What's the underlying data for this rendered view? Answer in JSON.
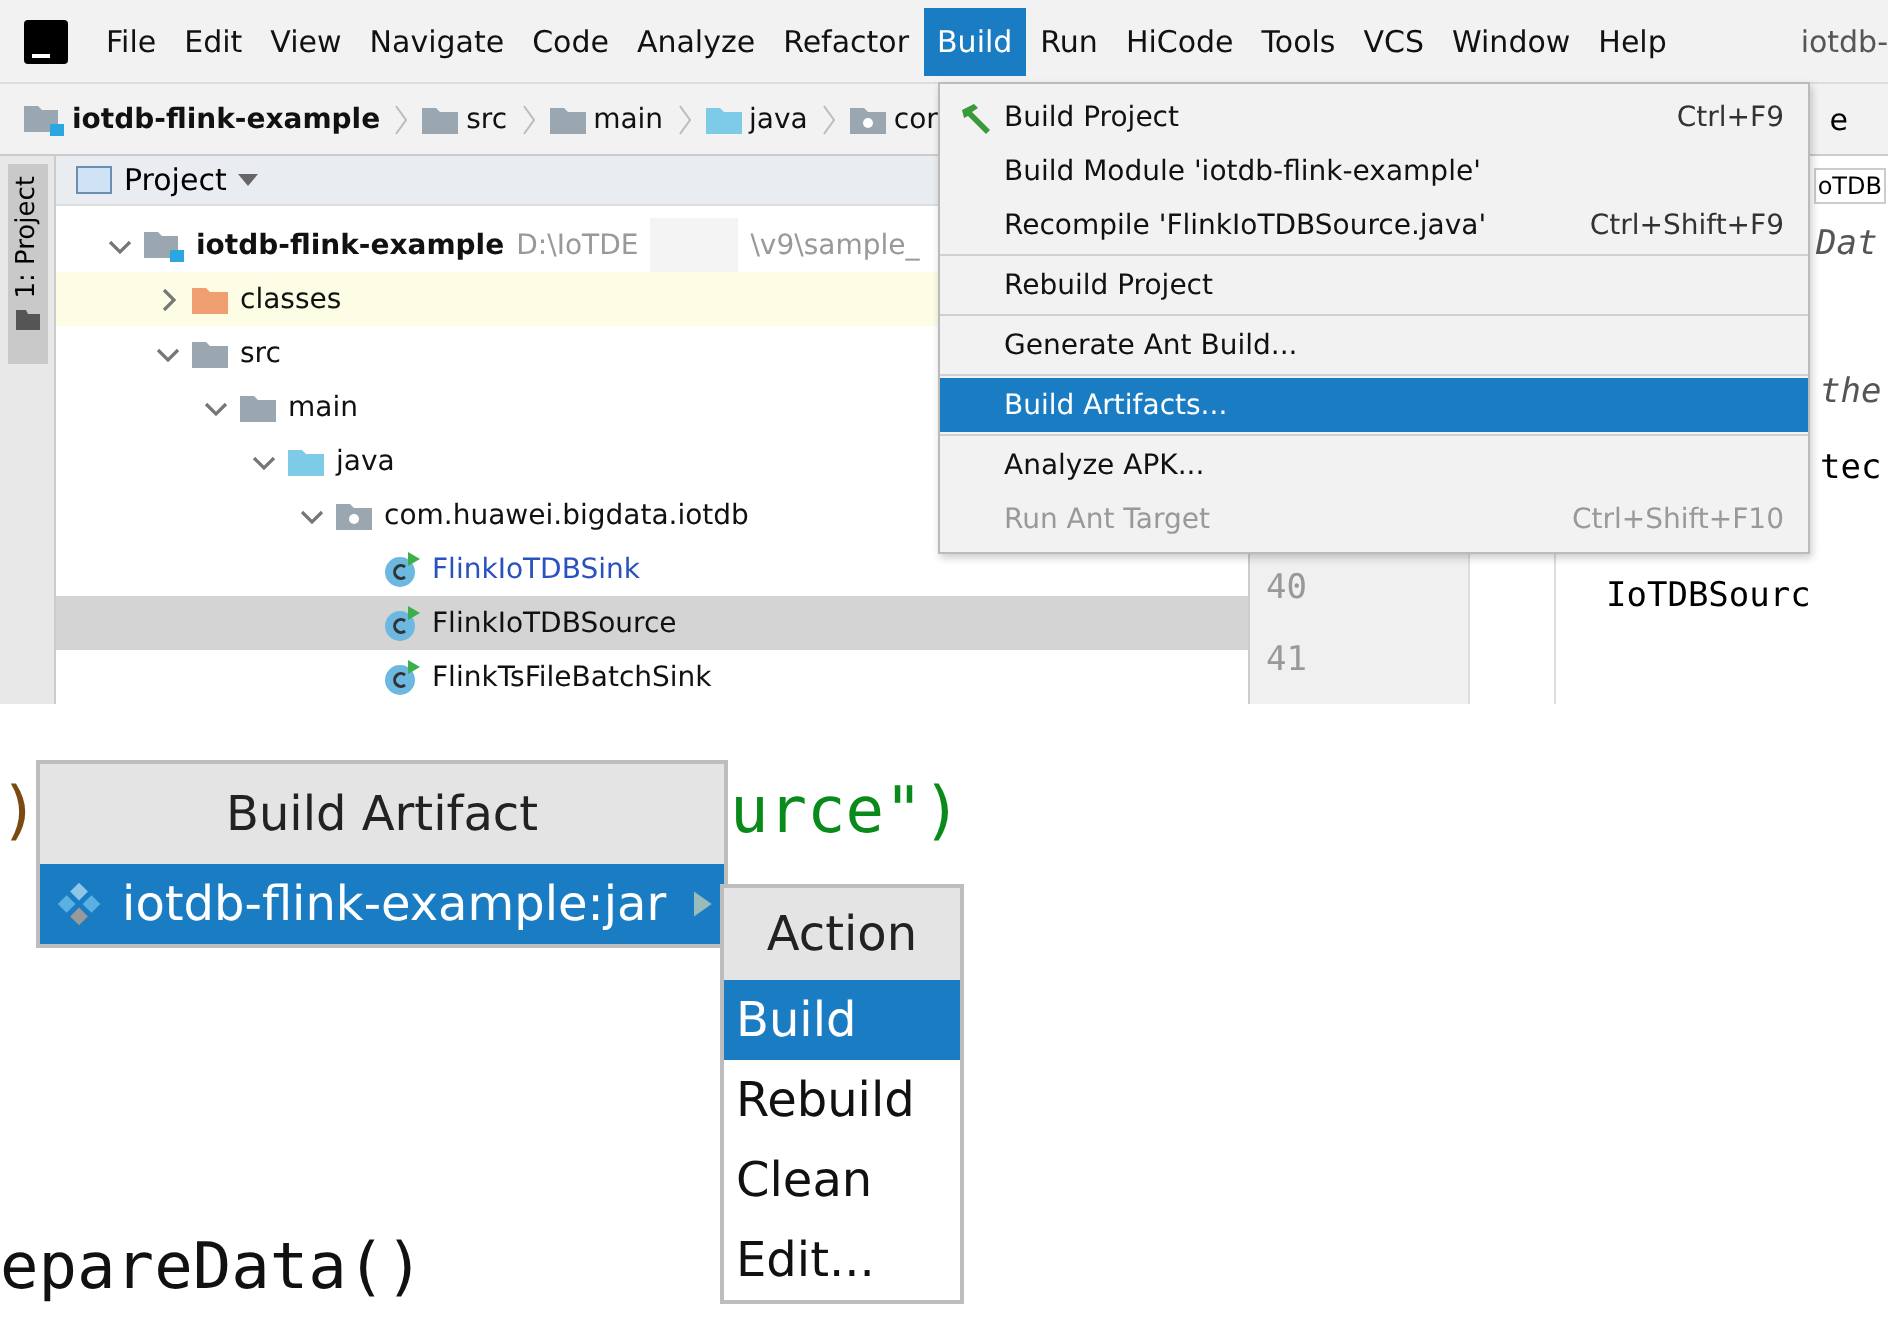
{
  "menubar": {
    "items": [
      {
        "label": "File",
        "selected": false
      },
      {
        "label": "Edit",
        "selected": false
      },
      {
        "label": "View",
        "selected": false
      },
      {
        "label": "Navigate",
        "selected": false
      },
      {
        "label": "Code",
        "selected": false
      },
      {
        "label": "Analyze",
        "selected": false
      },
      {
        "label": "Refactor",
        "selected": false
      },
      {
        "label": "Build",
        "selected": true
      },
      {
        "label": "Run",
        "selected": false
      },
      {
        "label": "HiCode",
        "selected": false
      },
      {
        "label": "Tools",
        "selected": false
      },
      {
        "label": "VCS",
        "selected": false
      },
      {
        "label": "Window",
        "selected": false
      },
      {
        "label": "Help",
        "selected": false
      }
    ],
    "title": "iotdb-"
  },
  "breadcrumbs": [
    {
      "label": "iotdb-flink-example",
      "kind": "module"
    },
    {
      "label": "src",
      "kind": "folder"
    },
    {
      "label": "main",
      "kind": "folder"
    },
    {
      "label": "java",
      "kind": "source"
    },
    {
      "label": "cor",
      "kind": "package"
    }
  ],
  "breadcrumb_tail": "e",
  "side_tab": "1: Project",
  "project_panel": {
    "title": "Project",
    "tree": [
      {
        "label": "iotdb-flink-example",
        "path_start": "D:\\IoTDE",
        "path_end": "\\v9\\sample_",
        "kind": "module",
        "expanded": true,
        "selected": false,
        "children": [
          {
            "label": "classes",
            "kind": "excluded",
            "expanded": false,
            "selected": false,
            "highlighted": true
          },
          {
            "label": "src",
            "kind": "folder",
            "expanded": true,
            "selected": false,
            "children": [
              {
                "label": "main",
                "kind": "folder",
                "expanded": true,
                "selected": false,
                "children": [
                  {
                    "label": "java",
                    "kind": "source",
                    "expanded": true,
                    "selected": false,
                    "children": [
                      {
                        "label": "com.huawei.bigdata.iotdb",
                        "kind": "package",
                        "expanded": true,
                        "selected": false,
                        "children": [
                          {
                            "label": "FlinkIoTDBSink",
                            "kind": "class",
                            "modified": true,
                            "selected": false
                          },
                          {
                            "label": "FlinkIoTDBSource",
                            "kind": "class",
                            "modified": false,
                            "selected": true
                          },
                          {
                            "label": "FlinkTsFileBatchSink",
                            "kind": "class",
                            "modified": false,
                            "selected": false
                          }
                        ]
                      }
                    ]
                  }
                ]
              }
            ]
          }
        ]
      }
    ]
  },
  "editor": {
    "tab": "oTDB",
    "line_numbers": [
      "40",
      "41"
    ],
    "snippets": [
      {
        "text": "Dat",
        "kind": "italic"
      },
      {
        "text": "the",
        "kind": "italic"
      },
      {
        "text": "tec",
        "kind": "plain"
      },
      {
        "text": "IoTDBSourc",
        "kind": "plain"
      }
    ]
  },
  "build_menu": {
    "groups": [
      [
        {
          "label": "Build Project",
          "shortcut": "Ctrl+F9",
          "icon": true,
          "disabled": false,
          "selected": false
        },
        {
          "label": "Build Module 'iotdb-flink-example'",
          "disabled": false,
          "selected": false
        },
        {
          "label": "Recompile 'FlinkIoTDBSource.java'",
          "shortcut": "Ctrl+Shift+F9",
          "disabled": false,
          "selected": false
        }
      ],
      [
        {
          "label": "Rebuild Project",
          "disabled": false,
          "selected": false
        }
      ],
      [
        {
          "label": "Generate Ant Build...",
          "disabled": false,
          "selected": false
        }
      ],
      [
        {
          "label": "Build Artifacts...",
          "disabled": false,
          "selected": true
        }
      ],
      [
        {
          "label": "Analyze APK...",
          "disabled": false,
          "selected": false
        },
        {
          "label": "Run Ant Target",
          "shortcut": "Ctrl+Shift+F10",
          "disabled": true,
          "selected": false
        }
      ]
    ]
  },
  "zoomed_view": {
    "code_lines": [
      {
        "text": ")",
        "kind": "paren"
      },
      {
        "text": "urce\")",
        "kind": "string"
      },
      {
        "text": "epareData()",
        "kind": "plain"
      }
    ],
    "artifact_popup": {
      "title": "Build Artifact",
      "items": [
        {
          "label": "iotdb-flink-example:jar",
          "selected": true
        }
      ]
    },
    "action_popup": {
      "title": "Action",
      "items": [
        {
          "label": "Build",
          "selected": true
        },
        {
          "label": "Rebuild",
          "selected": false
        },
        {
          "label": "Clean",
          "selected": false
        },
        {
          "label": "Edit...",
          "selected": false
        }
      ]
    }
  }
}
